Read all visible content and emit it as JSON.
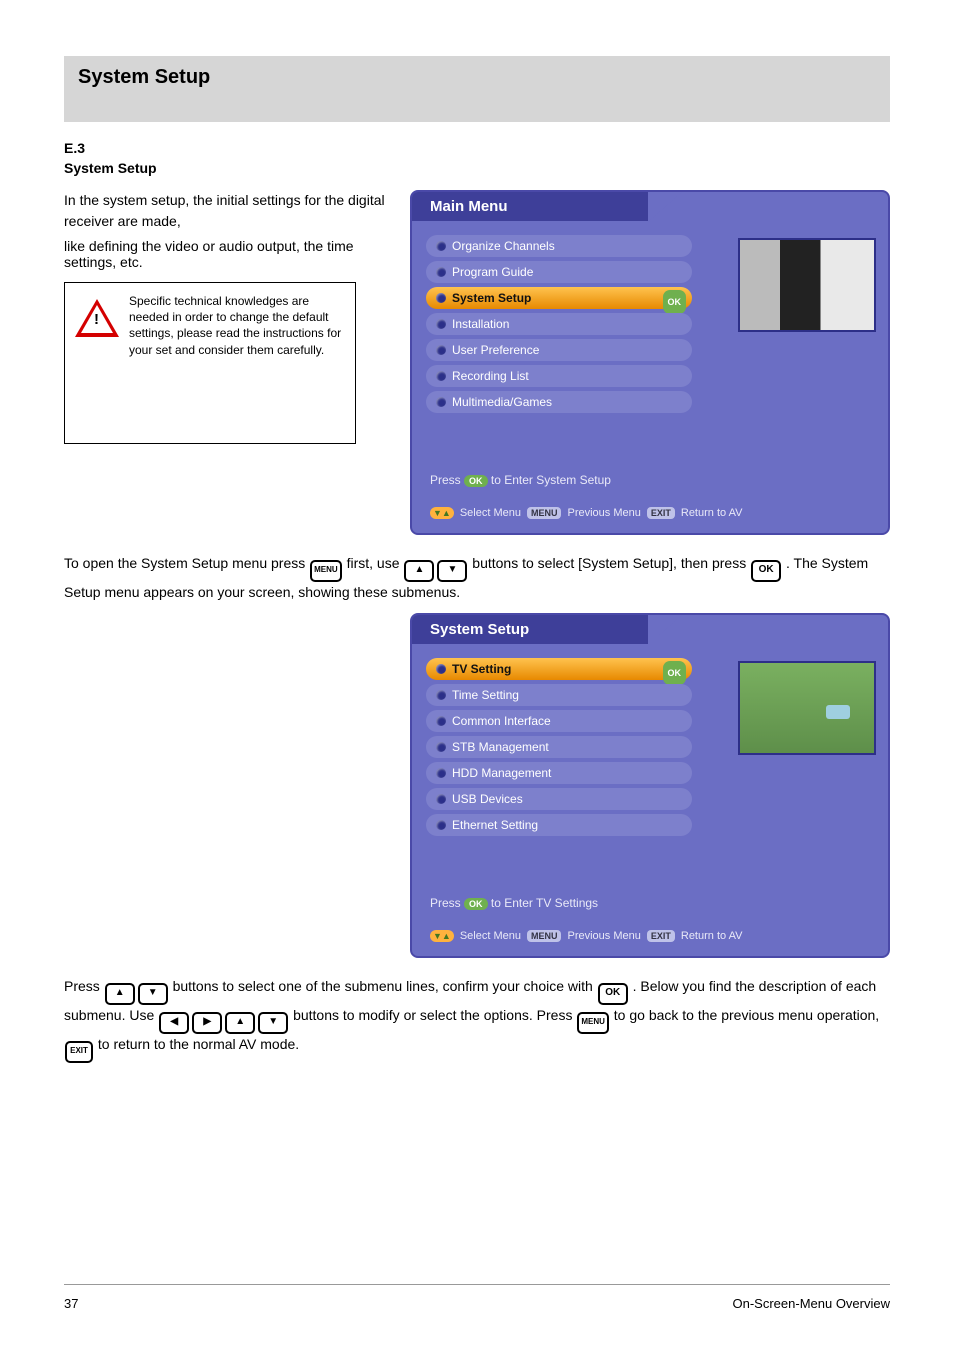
{
  "banner": "System Setup",
  "section_num": "E.3",
  "section_title": "System Setup",
  "intro_line1": "In the system setup, the initial settings for the digital receiver are made,",
  "intro_line2": "like defining the video or audio output, the time settings, etc.",
  "warn_note": "Specific technical knowledges are needed in order to change the default settings, please read the instructions for your set and consider them carefully.",
  "main_menu": {
    "title": "Main Menu",
    "items": [
      {
        "label": "Organize Channels",
        "selected": false
      },
      {
        "label": "Program Guide",
        "selected": false
      },
      {
        "label": "System Setup",
        "selected": true
      },
      {
        "label": "Installation",
        "selected": false
      },
      {
        "label": "User Preference",
        "selected": false
      },
      {
        "label": "Recording List",
        "selected": false
      },
      {
        "label": "Multimedia/Games",
        "selected": false
      }
    ],
    "hint_prefix": "Press",
    "hint_suffix": "to Enter System Setup",
    "footer_select": "Select Menu",
    "footer_prev": "Previous Menu",
    "footer_exit": "Return to AV"
  },
  "step1_a": "To open the System Setup menu press",
  "step1_b": "first, use",
  "step1_c": "buttons to select [System Setup], then press",
  "step1_d": ". The System Setup menu appears on your screen, showing these submenus.",
  "system_setup": {
    "title": "System Setup",
    "items": [
      {
        "label": "TV Setting",
        "selected": true
      },
      {
        "label": "Time Setting",
        "selected": false
      },
      {
        "label": "Common Interface",
        "selected": false
      },
      {
        "label": "STB Management",
        "selected": false
      },
      {
        "label": "HDD Management",
        "selected": false
      },
      {
        "label": "USB Devices",
        "selected": false
      },
      {
        "label": "Ethernet Setting",
        "selected": false
      }
    ],
    "hint_prefix": "Press",
    "hint_suffix": "to Enter TV Settings",
    "footer_select": "Select Menu",
    "footer_prev": "Previous Menu",
    "footer_exit": "Return to AV"
  },
  "step2_a": "Press",
  "step2_b": "buttons to select one of the submenu lines, confirm your choice with",
  "step2_c": ". Below you find the description of each submenu. Use",
  "step2_d": "buttons to modify or select the options.",
  "step2_e": "to go back to the previous menu operation,",
  "step2_f": "to return to the normal AV mode.",
  "keys": {
    "menu": "MENU",
    "ok": "OK",
    "up": "▲",
    "down": "▼",
    "left": "◀",
    "right": "▶",
    "exit": "EXIT"
  },
  "badges": {
    "ok": "OK",
    "updown": "▼▲",
    "menu": "MENU",
    "exit": "EXIT"
  },
  "page_num": "37",
  "page_label": "On-Screen-Menu Overview"
}
